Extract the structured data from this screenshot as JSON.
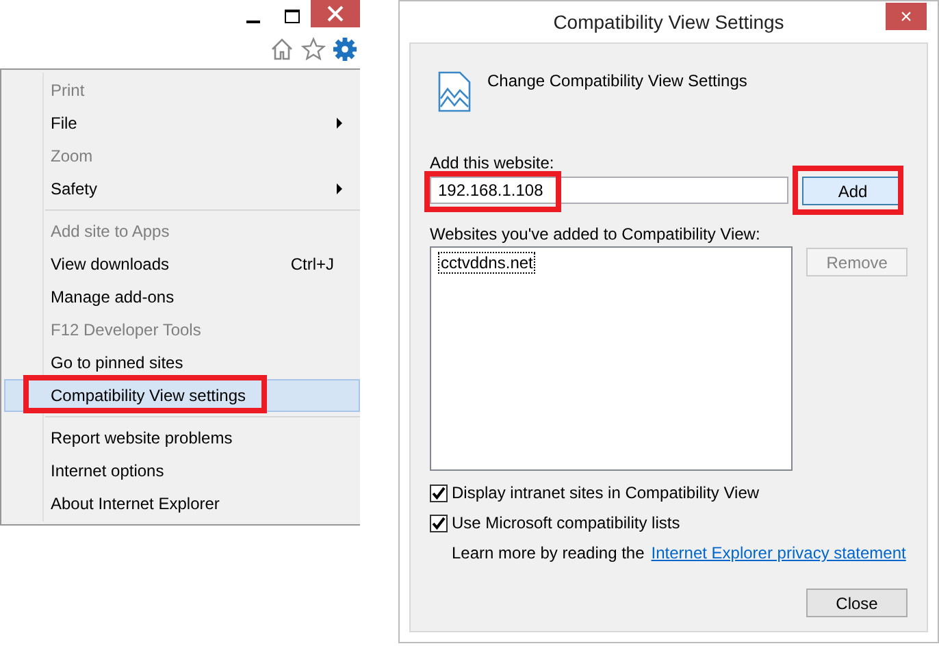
{
  "menu": {
    "items": [
      {
        "kind": "item",
        "label": "Print",
        "disabled": true,
        "submenu": false,
        "selected": false,
        "annotated": false
      },
      {
        "kind": "item",
        "label": "File",
        "disabled": false,
        "submenu": true,
        "selected": false,
        "annotated": false
      },
      {
        "kind": "item",
        "label": "Zoom",
        "disabled": true,
        "submenu": false,
        "selected": false,
        "annotated": false
      },
      {
        "kind": "item",
        "label": "Safety",
        "disabled": false,
        "submenu": true,
        "selected": false,
        "annotated": false
      },
      {
        "kind": "separator"
      },
      {
        "kind": "item",
        "label": "Add site to Apps",
        "disabled": true,
        "submenu": false,
        "selected": false,
        "annotated": false
      },
      {
        "kind": "item",
        "label": "View downloads",
        "shortcut": "Ctrl+J",
        "disabled": false,
        "submenu": false,
        "selected": false,
        "annotated": false
      },
      {
        "kind": "item",
        "label": "Manage add-ons",
        "disabled": false,
        "submenu": false,
        "selected": false,
        "annotated": false
      },
      {
        "kind": "item",
        "label": "F12 Developer Tools",
        "disabled": true,
        "submenu": false,
        "selected": false,
        "annotated": false
      },
      {
        "kind": "item",
        "label": "Go to pinned sites",
        "disabled": false,
        "submenu": false,
        "selected": false,
        "annotated": false
      },
      {
        "kind": "item",
        "label": "Compatibility View settings",
        "disabled": false,
        "submenu": false,
        "selected": true,
        "annotated": true
      },
      {
        "kind": "separator"
      },
      {
        "kind": "item",
        "label": "Report website problems",
        "disabled": false,
        "submenu": false,
        "selected": false,
        "annotated": false
      },
      {
        "kind": "item",
        "label": "Internet options",
        "disabled": false,
        "submenu": false,
        "selected": false,
        "annotated": false
      },
      {
        "kind": "item",
        "label": "About Internet Explorer",
        "disabled": false,
        "submenu": false,
        "selected": false,
        "annotated": false
      }
    ]
  },
  "dialog": {
    "title": "Compatibility View Settings",
    "close": "×",
    "heading": "Change Compatibility View Settings",
    "add_label": "Add this website:",
    "url_field": {
      "value": "192.168.1.108",
      "annotated": true
    },
    "add_button": {
      "label": "Add",
      "annotated": true,
      "disabled": false
    },
    "list_label": "Websites you've added to Compatibility View:",
    "websites": [
      "cctvddns.net"
    ],
    "remove_button": {
      "label": "Remove",
      "disabled": true
    },
    "checkboxes": [
      {
        "label": "Display intranet sites in Compatibility View",
        "checked": true
      },
      {
        "label": "Use Microsoft compatibility lists",
        "checked": true
      }
    ],
    "learn_more": "Learn more by reading the",
    "privacy_link": "Internet Explorer privacy statement",
    "close_button": "Close"
  }
}
